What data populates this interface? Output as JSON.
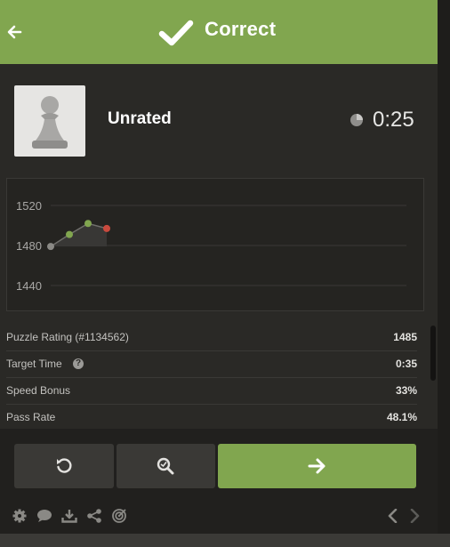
{
  "header": {
    "title": "Correct"
  },
  "puzzle": {
    "rating_mode": "Unrated",
    "timer": "0:25"
  },
  "chart_data": {
    "type": "line",
    "title": "",
    "xlabel": "",
    "ylabel": "",
    "y_ticks": [
      "1520",
      "1480",
      "1440"
    ],
    "ylim": [
      1440,
      1520
    ],
    "grid": true,
    "series": [
      {
        "values": [
          1479,
          1491,
          1502,
          1497
        ]
      }
    ],
    "point_colors": [
      "#8a8985",
      "#81a64f",
      "#81a64f",
      "#c94a3e"
    ]
  },
  "stats": [
    {
      "label": "Puzzle Rating (#1134562)",
      "value": "1485"
    },
    {
      "label": "Target Time",
      "value": "0:35"
    },
    {
      "label": "Speed Bonus",
      "value": "33%"
    },
    {
      "label": "Pass Rate",
      "value": "48.1%"
    }
  ],
  "icons": {
    "header": [
      "back-arrow-icon",
      "checkmark-icon"
    ],
    "actions": [
      "retry-icon",
      "analysis-icon",
      "next-arrow-icon"
    ],
    "footer": [
      "gear-icon",
      "chat-icon",
      "download-icon",
      "share-icon",
      "target-icon",
      "chevron-left-icon",
      "chevron-right-icon"
    ]
  },
  "colors": {
    "accent": "#81a64f",
    "background": "#2a2926",
    "error": "#c94a3e"
  }
}
